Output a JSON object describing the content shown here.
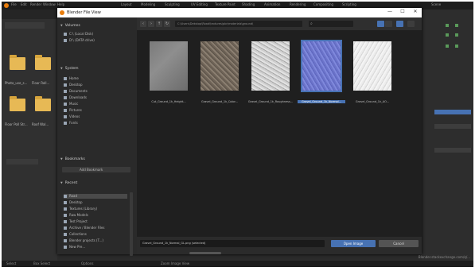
{
  "app": {
    "dialog_title": "Blender File View",
    "window_buttons": [
      "—",
      "☐",
      "✕"
    ]
  },
  "main_menu": {
    "items": [
      "File",
      "Edit",
      "Render",
      "Window",
      "Help"
    ],
    "workspaces": [
      "Layout",
      "Modeling",
      "Sculpting",
      "UV Editing",
      "Texture Paint",
      "Shading",
      "Animation",
      "Rendering",
      "Compositing",
      "Scripting"
    ],
    "scene": "Scene"
  },
  "left_editor": {
    "folders": [
      {
        "label": "Photo_use_s..."
      },
      {
        "label": "Floor Roll..."
      },
      {
        "label": "Floor Poll Str..."
      },
      {
        "label": "Roof Wal..."
      }
    ]
  },
  "sidebar": {
    "volumes_header": "Volumes",
    "volumes": [
      "C:\\ (Local Disk)",
      "D:\\ (DATA drive)"
    ],
    "system_header": "System",
    "system": [
      "Home",
      "Desktop",
      "Documents",
      "Downloads",
      "Music",
      "Pictures",
      "Videos",
      "Fonts"
    ],
    "bookmarks_header": "Bookmarks",
    "bookmarks_add": "Add Bookmark",
    "recent_header": "Recent",
    "recent": [
      "Road",
      "Desktop",
      "Textures (Library)",
      "Raw Models",
      "Test Project",
      "Archive / Blender Files",
      "Collections",
      "Blender projects (T...)",
      "New Pre..."
    ]
  },
  "toolbar": {
    "path": "C:\\Users\\Dekstop\\Road\\textures\\pbr\\materials\\ground\\",
    "search_placeholder": "⌕"
  },
  "files": [
    {
      "label": "Cut_Ground_1k_Height..."
    },
    {
      "label": "Gravel_Ground_1k_Color..."
    },
    {
      "label": "Gravel_Ground_1k_Roughness..."
    },
    {
      "label": "Gravel_Ground_1k_Normal..."
    },
    {
      "label": "Gravel_Ground_1k_AO..."
    }
  ],
  "footer": {
    "filename": "Gravel_Ground_1k_Normal_GL.png (selected)",
    "ok_label": "Open Image",
    "cancel_label": "Cancel"
  },
  "status": {
    "items": [
      "Select",
      "Box Select",
      "Options",
      "Zoom Image View"
    ]
  },
  "watermark": "Blender.stackexchange.com/q/..."
}
